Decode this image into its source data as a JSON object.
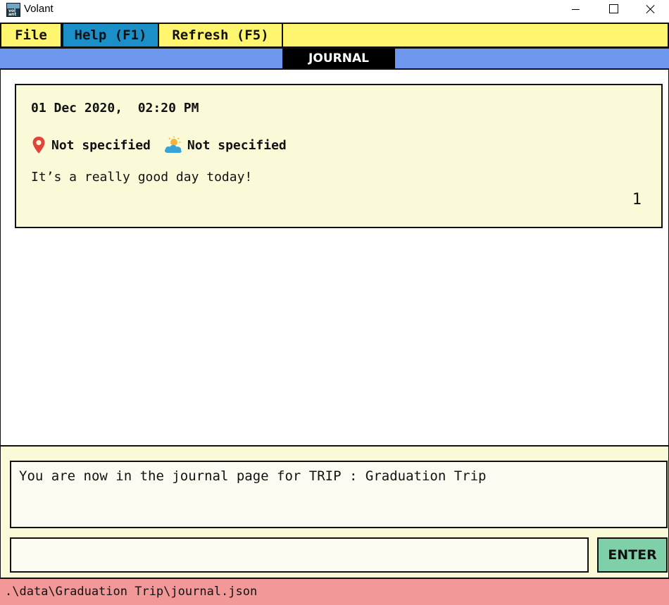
{
  "window": {
    "title": "Volant",
    "icon": "volant-app-icon",
    "icon_text": "vol\nant"
  },
  "menu": {
    "file": "File",
    "help": "Help (F1)",
    "refresh": "Refresh (F5)"
  },
  "header": {
    "tab": "JOURNAL"
  },
  "journal": {
    "entries": [
      {
        "datetime": "01 Dec 2020,  02:20 PM",
        "location": "Not specified",
        "location_icon": "map-pin-icon",
        "weather": "Not specified",
        "weather_icon": "sun-cloud-icon",
        "text": "It’s a really good day today!",
        "index": "1"
      }
    ]
  },
  "result": {
    "message": "You are now in the journal page for TRIP : Graduation Trip"
  },
  "command": {
    "value": "",
    "enter_label": "ENTER"
  },
  "status": {
    "path": ".\\data\\Graduation Trip\\journal.json"
  },
  "colors": {
    "menu_bg": "#fff56e",
    "menu_active": "#1a8fc8",
    "header_bg": "#6e97ee",
    "card_bg": "#fbfad8",
    "enter_bg": "#7fcfa8",
    "status_bg": "#f29898"
  }
}
